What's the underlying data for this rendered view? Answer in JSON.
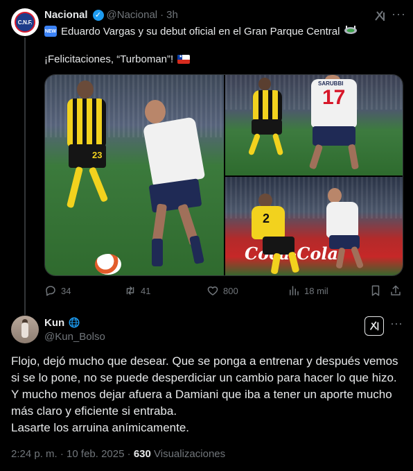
{
  "parent": {
    "display_name": "Nacional",
    "handle": "@Nacional",
    "separator": "·",
    "time": "3h",
    "avatar_text": "C.N.F.",
    "line1": "Eduardo Vargas y su debut oficial en el Gran Parque Central",
    "line2": "¡Felicitaciones, “Turboman”!",
    "new_badge": "NEW",
    "photo_texts": {
      "shirt_name": "SARUBBI",
      "shirt_number": "17",
      "opponent_number_1": "23",
      "opponent_number_2": "2",
      "ad_text": "Coca-Cola"
    },
    "actions": {
      "replies": "34",
      "reposts": "41",
      "likes": "800",
      "views": "18 mil"
    }
  },
  "reply": {
    "display_name": "Kun",
    "handle": "@Kun_Bolso",
    "text": [
      "Flojo, dejó mucho que desear. Que se ponga a entrenar y después vemos",
      "si se lo pone, no se puede desperdiciar un cambio para hacer lo que hizo.",
      "Y mucho menos dejar afuera a Damiani que iba a tener un aporte mucho",
      "más claro y eficiente si entraba.",
      "Lasarte los arruina anímicamente."
    ],
    "time": "2:24 p. m.",
    "dot": "·",
    "date": "10 feb. 2025",
    "views_count": "630",
    "views_label": "Visualizaciones"
  },
  "colors": {
    "background": "#000000",
    "text": "#e7e9ea",
    "muted": "#71767b",
    "verified": "#1d9bf0",
    "divider": "#2f3336"
  }
}
